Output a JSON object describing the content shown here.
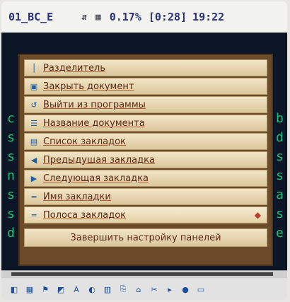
{
  "status": {
    "doc": "01_BC_E",
    "icons": "⇵ ▦",
    "percent": "0.17%",
    "page": "[0:28]",
    "time": "19:22"
  },
  "gutter_left": [
    "c",
    "s",
    "s",
    "n",
    "s",
    "s",
    "d"
  ],
  "gutter_right": [
    "b",
    "d",
    "s",
    "s",
    "a",
    "s",
    "e"
  ],
  "menu": {
    "items": [
      {
        "label": "Разделитель",
        "icon": "separator-icon",
        "glyph": "│"
      },
      {
        "label": "Закрыть документ",
        "icon": "close-document-icon",
        "glyph": "▣"
      },
      {
        "label": "Выйти из программы",
        "icon": "exit-icon",
        "glyph": "↺"
      },
      {
        "label": "Название документа",
        "icon": "document-title-icon",
        "glyph": "☰"
      },
      {
        "label": "Список закладок",
        "icon": "bookmarks-list-icon",
        "glyph": "▤"
      },
      {
        "label": "Предыдущая закладка",
        "icon": "previous-bookmark-icon",
        "glyph": "◀"
      },
      {
        "label": "Следующая закладка",
        "icon": "next-bookmark-icon",
        "glyph": "▶"
      },
      {
        "label": "Имя закладки",
        "icon": "bookmark-name-icon",
        "glyph": "═"
      },
      {
        "label": "Полоса закладок",
        "icon": "bookmark-bar-icon",
        "glyph": "═"
      }
    ],
    "bottom_label": "Завершить настройку панелей"
  },
  "toolbar_icons": [
    "◧",
    "▦",
    "⚑",
    "◩",
    "A",
    "◐",
    "▥",
    "⎘",
    "⌂",
    "✂",
    "▸",
    "●",
    "▭"
  ]
}
